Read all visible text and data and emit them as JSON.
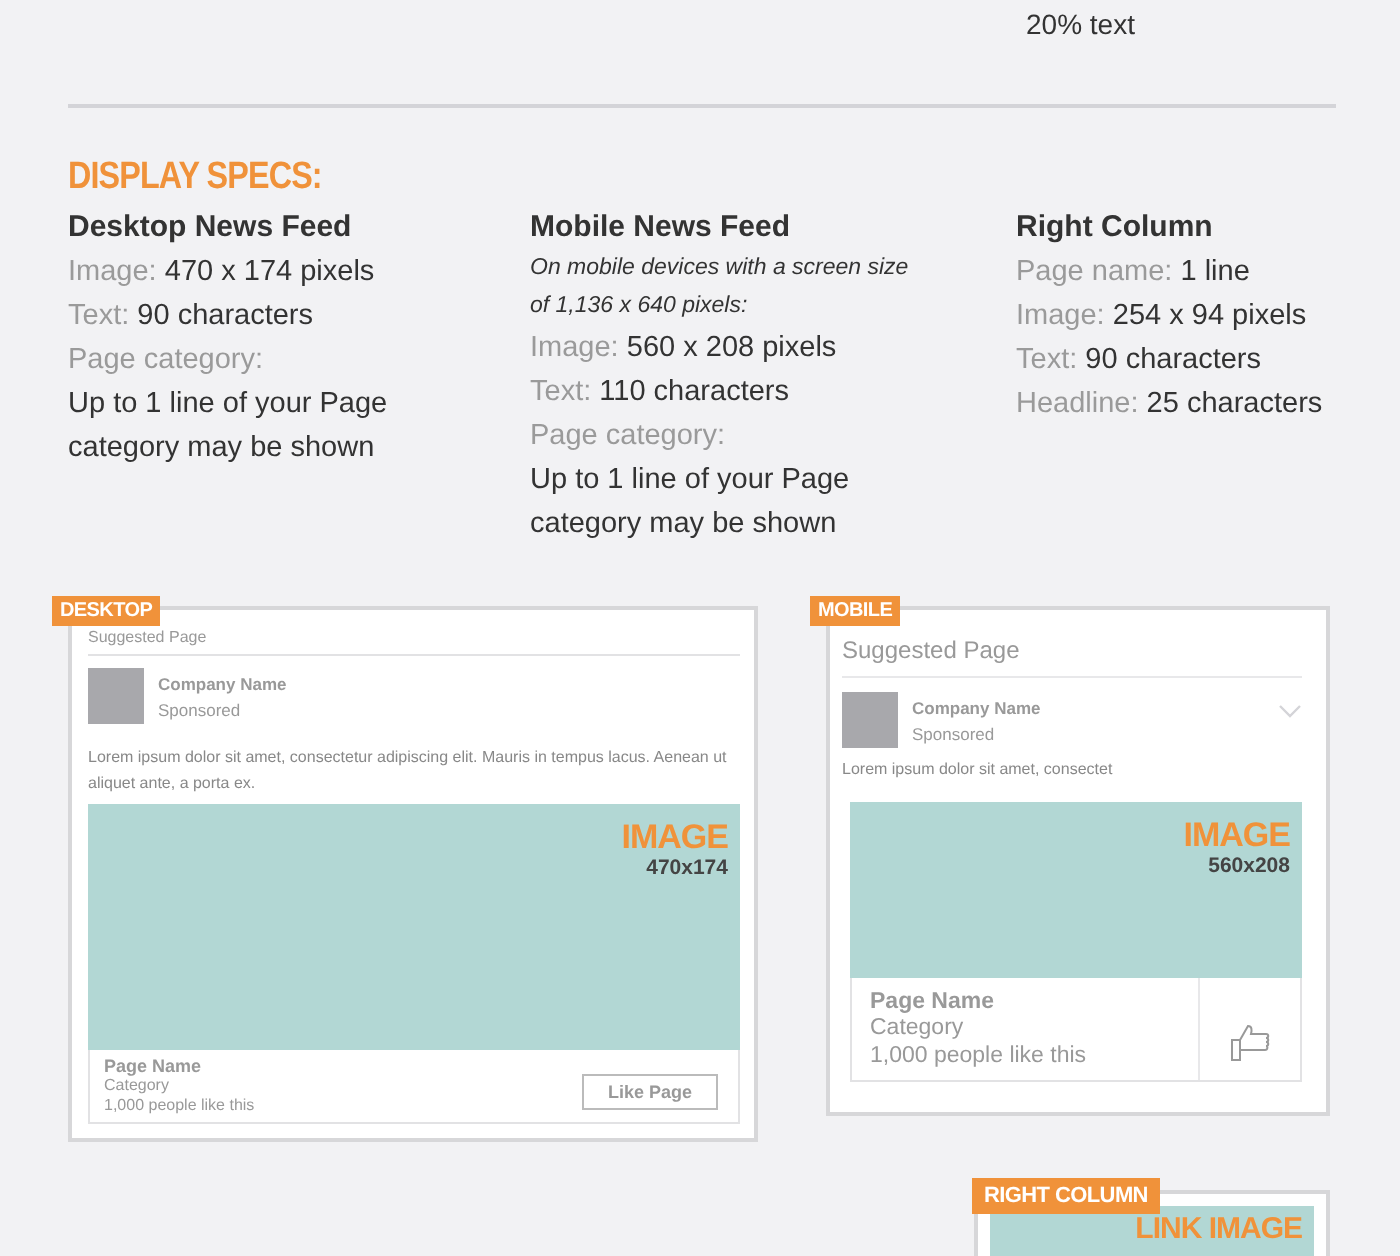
{
  "top_note": "20% text",
  "section_title": "DISPLAY SPECS:",
  "spec_columns": [
    {
      "heading": "Desktop News Feed",
      "specs": [
        {
          "label": "Image:",
          "value": "470 x 174 pixels"
        },
        {
          "label": "Text:",
          "value": "90 characters"
        },
        {
          "label": "Page category:",
          "value": "Up to 1 line of your Page category may be shown"
        }
      ]
    },
    {
      "heading": "Mobile News Feed",
      "note": "On mobile devices with a screen size of 1,136 x 640 pixels:",
      "specs": [
        {
          "label": "Image:",
          "value": "560 x 208 pixels"
        },
        {
          "label": "Text:",
          "value": "110 characters"
        },
        {
          "label": "Page category:",
          "value": "Up to 1 line of your Page category may be shown"
        }
      ]
    },
    {
      "heading": "Right Column",
      "specs": [
        {
          "label": "Page name:",
          "value": "1 line"
        },
        {
          "label": "Image:",
          "value": "254 x 94 pixels"
        },
        {
          "label": "Text:",
          "value": "90 characters"
        },
        {
          "label": "Headline:",
          "value": "25 characters"
        }
      ]
    }
  ],
  "previews": [
    {
      "kind": "desktop",
      "tag": "DESKTOP",
      "suggested": "Suggested Page",
      "company": "Company Name",
      "sponsored": "Sponsored",
      "body": "Lorem ipsum dolor sit amet, consectetur adipiscing elit. Mauris in tempus lacus. Aenean ut aliquet ante, a porta ex.",
      "image_label": "IMAGE",
      "image_size": "470x174",
      "page_name": "Page Name",
      "category": "Category",
      "likes": "1,000 people like this",
      "button": "Like Page"
    },
    {
      "kind": "mobile",
      "tag": "MOBILE",
      "suggested": "Suggested Page",
      "company": "Company Name",
      "sponsored": "Sponsored",
      "body": "Lorem ipsum dolor sit amet, consectet",
      "image_label": "IMAGE",
      "image_size": "560x208",
      "page_name": "Page Name",
      "category": "Category",
      "likes": "1,000 people like this"
    }
  ],
  "right_column": {
    "tag": "RIGHT COLUMN",
    "image_label": "LINK IMAGE"
  }
}
